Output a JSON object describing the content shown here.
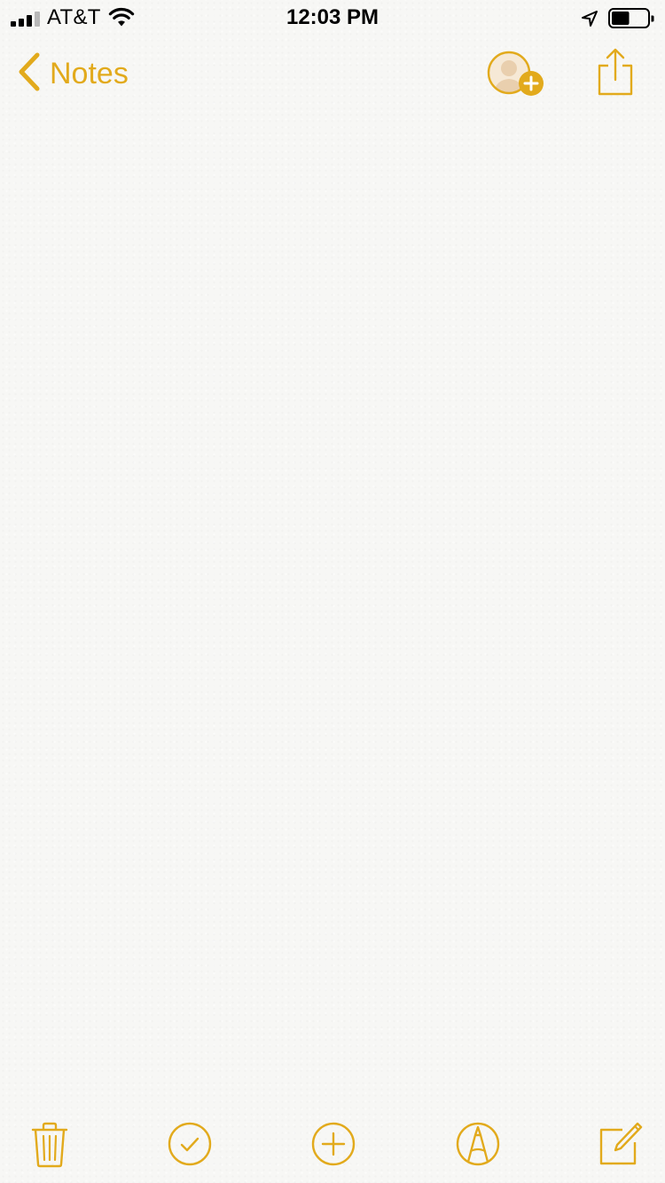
{
  "status_bar": {
    "carrier": "AT&T",
    "time": "12:03 PM",
    "signal_bars_active": 3,
    "signal_bars_total": 4,
    "battery_level": 0.5
  },
  "nav": {
    "back_label": "Notes"
  },
  "icons": {
    "back": "chevron-left-icon",
    "collaborate": "add-person-icon",
    "share": "share-icon",
    "delete": "trash-icon",
    "checklist": "checkmark-circle-icon",
    "add": "plus-circle-icon",
    "markup": "pen-tip-circle-icon",
    "compose": "compose-icon"
  },
  "colors": {
    "accent": "#e2aa1c",
    "background": "#f7f7f5",
    "status_text": "#000000",
    "signal_inactive": "#b8b8b8"
  }
}
